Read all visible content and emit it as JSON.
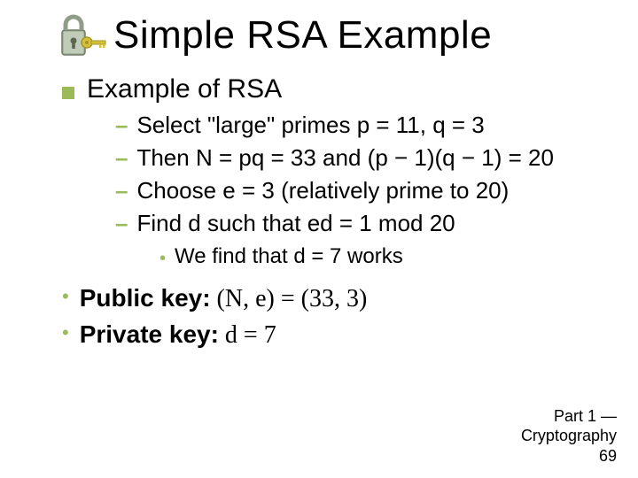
{
  "title": "Simple RSA Example",
  "heading": "Example of RSA",
  "items": [
    "Select \"large\" primes p = 11, q = 3",
    "Then N =  pq = 33 and (p − 1)(q − 1) = 20",
    "Choose e = 3 (relatively prime to 20)",
    "Find d such that ed = 1 mod 20"
  ],
  "subnote": "We find that  d = 7 works",
  "pubkey_label": "Public key:",
  "pubkey_value": " (N, e) = (33, 3)",
  "privkey_label": "Private key:",
  "privkey_value": " d = 7",
  "footer_part": "Part 1 —",
  "footer_topic": "Cryptography",
  "footer_page": "69"
}
